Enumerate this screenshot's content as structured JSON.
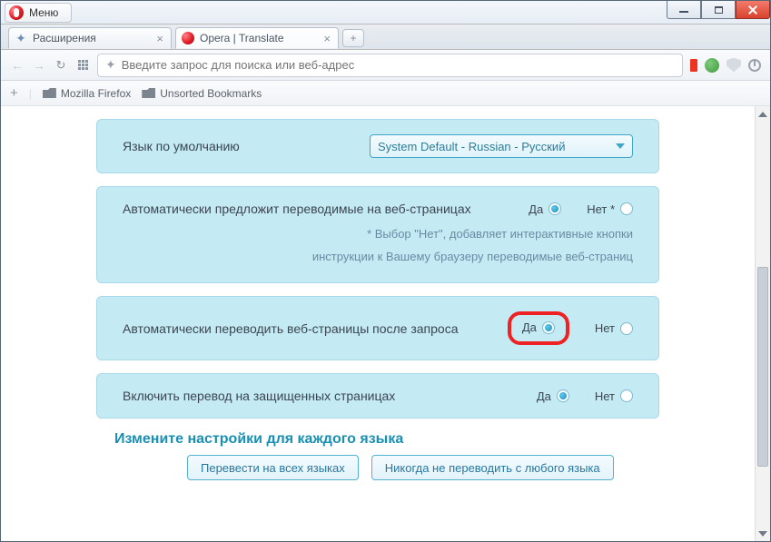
{
  "window": {
    "menu_label": "Меню"
  },
  "tabs": [
    {
      "title": "Расширения",
      "icon": "ext"
    },
    {
      "title": "Opera | Translate",
      "icon": "opera",
      "active": true
    }
  ],
  "addressbar": {
    "placeholder": "Введите запрос для поиска или веб-адрес"
  },
  "bookmarks": {
    "folders": [
      "Mozilla Firefox",
      "Unsorted Bookmarks"
    ]
  },
  "settings": {
    "default_lang": {
      "label": "Язык по умолчанию",
      "value": "System Default - Russian - Русский"
    },
    "auto_suggest": {
      "label": "Автоматически предложит переводимые на веб-страницах",
      "hint1": "* Выбор \"Нет\", добавляет интерактивные кнопки",
      "hint2": "инструкции к Вашему браузеру переводимые веб-страниц",
      "yes": "Да",
      "no": "Нет *",
      "selected": "yes"
    },
    "auto_translate": {
      "label": "Автоматически переводить веб-страницы после запроса",
      "yes": "Да",
      "no": "Нет",
      "selected": "yes"
    },
    "secure_pages": {
      "label": "Включить перевод на защищенных страницах",
      "yes": "Да",
      "no": "Нет",
      "selected": "yes"
    },
    "per_lang_heading": "Измените настройки для каждого языка",
    "btn_translate_all": "Перевести на всех языках",
    "btn_never_translate": "Никогда не переводить с любого языка"
  }
}
